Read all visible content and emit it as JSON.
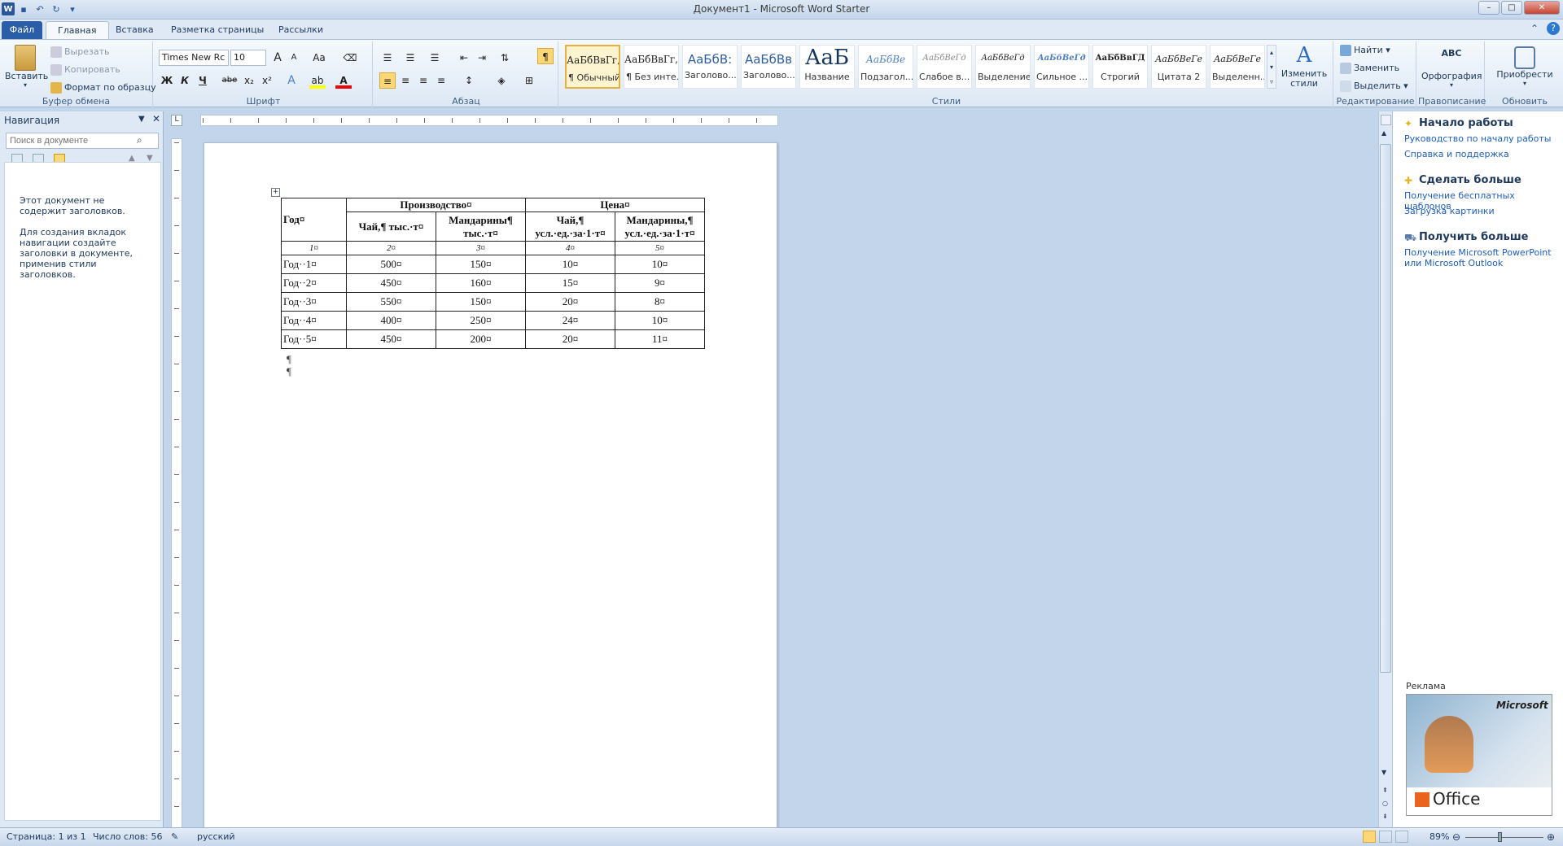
{
  "title": "Документ1  -  Microsoft Word Starter",
  "tabs": {
    "file": "Файл",
    "home": "Главная",
    "insert": "Вставка",
    "layout": "Разметка страницы",
    "mailings": "Рассылки"
  },
  "clipboard": {
    "paste": "Вставить",
    "cut": "Вырезать",
    "copy": "Копировать",
    "format_painter": "Формат по образцу",
    "group": "Буфер обмена"
  },
  "font": {
    "name": "Times New Rc",
    "size": "10",
    "group": "Шрифт",
    "bold": "Ж",
    "italic": "К",
    "underline": "Ч",
    "strike": "abe",
    "sub": "x₂",
    "sup": "x²",
    "grow": "A",
    "shrink": "A",
    "case": "Aa"
  },
  "paragraph": {
    "group": "Абзац",
    "pilcrow": "¶"
  },
  "styles": {
    "group": "Стили",
    "items": [
      {
        "sample": "АаБбВвГг,",
        "name": "¶ Обычный"
      },
      {
        "sample": "АаБбВвГг,",
        "name": "¶ Без инте..."
      },
      {
        "sample": "АаБбВ:",
        "name": "Заголово..."
      },
      {
        "sample": "АаБбВв",
        "name": "Заголово..."
      },
      {
        "sample": "АаБ",
        "name": "Название"
      },
      {
        "sample": "АаБбВе",
        "name": "Подзагол..."
      },
      {
        "sample": "АаБбВеГд",
        "name": "Слабое в..."
      },
      {
        "sample": "АаБбВеГд",
        "name": "Выделение"
      },
      {
        "sample": "АаБбВеГд",
        "name": "Сильное ..."
      },
      {
        "sample": "АаБбВвГД",
        "name": "Строгий"
      },
      {
        "sample": "АаБбВеГе",
        "name": "Цитата 2"
      },
      {
        "sample": "АаБбВеГе",
        "name": "Выделенн..."
      }
    ],
    "change": "Изменить стили"
  },
  "editing": {
    "group": "Редактирование",
    "find": "Найти",
    "replace": "Заменить",
    "select": "Выделить"
  },
  "proofing": {
    "group": "Правописание",
    "spelling": "Орфография",
    "icon": "ABC"
  },
  "upgrade": {
    "group": "Обновить",
    "buy": "Приобрести"
  },
  "nav": {
    "title": "Навигация",
    "search_placeholder": "Поиск в документе",
    "msg1": "Этот документ не содержит заголовков.",
    "msg2": "Для создания вкладок навигации создайте заголовки в документе, применив стили заголовков."
  },
  "table": {
    "year_header": "Год¤",
    "production": "Производство¤",
    "price": "Цена¤",
    "subheaders": [
      "Чай,¶ тыс.·т¤",
      "Мандарины¶ тыс.·т¤",
      "Чай,¶ усл.·ед.·за·1·т¤",
      "Мандарины,¶ усл.·ед.·за·1·т¤"
    ],
    "index_row": [
      "1¤",
      "2¤",
      "3¤",
      "4¤",
      "5¤"
    ],
    "rows": [
      [
        "Год··1¤",
        "500¤",
        "150¤",
        "10¤",
        "10¤"
      ],
      [
        "Год··2¤",
        "450¤",
        "160¤",
        "15¤",
        "9¤"
      ],
      [
        "Год··3¤",
        "550¤",
        "150¤",
        "20¤",
        "8¤"
      ],
      [
        "Год··4¤",
        "400¤",
        "250¤",
        "24¤",
        "10¤"
      ],
      [
        "Год··5¤",
        "450¤",
        "200¤",
        "20¤",
        "11¤"
      ]
    ],
    "end_mark": "¤",
    "para_marks": [
      "¶",
      "¶"
    ]
  },
  "right_panel": {
    "h1": "Начало работы",
    "l1a": "Руководство по началу работы",
    "l1b": "Справка и поддержка",
    "h2": "Сделать больше",
    "l2a": "Получение бесплатных шаблонов",
    "l2b": "Загрузка картинки",
    "h3": "Получить больше",
    "l3a": "Получение Microsoft PowerPoint или Microsoft Outlook",
    "ad": "Реклама",
    "ad_brand": "Microsoft",
    "ad_product": "Office"
  },
  "status": {
    "page": "Страница: 1 из 1",
    "words": "Число слов: 56",
    "lang": "русский",
    "zoom": "89%"
  },
  "colors": {
    "accent": "#2b579a",
    "file_tab": "#2a5fa8",
    "link": "#1f5fb5"
  }
}
